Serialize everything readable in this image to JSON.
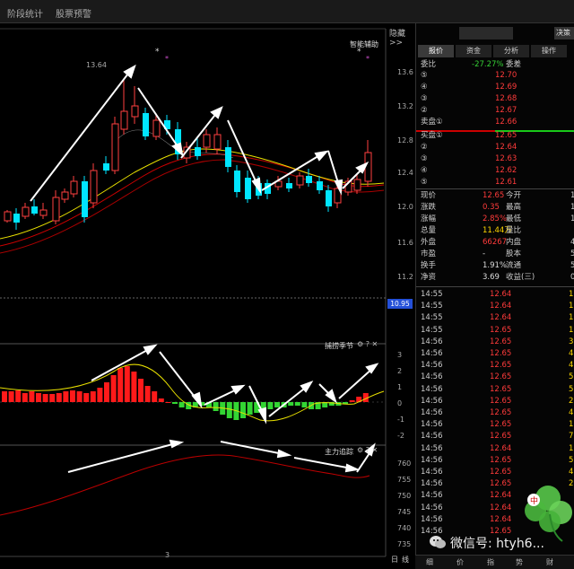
{
  "topbar": {
    "tab1": "阶段统计",
    "tab2": "股票预警"
  },
  "chart": {
    "hide_label": "隐藏>>",
    "assist_label": "智能辅助",
    "star": "*",
    "high_mark": "13.64",
    "current_price_tag": "10.95",
    "price_axis": [
      "13.6",
      "13.2",
      "12.8",
      "12.4",
      "12.0",
      "11.6",
      "11.2"
    ],
    "indicator1_label": "捕捞季节",
    "indicator1_axis": [
      "3",
      "2",
      "1",
      "0",
      "-1",
      "-2"
    ],
    "indicator2_label": "主力追踪",
    "indicator2_axis": [
      "760",
      "755",
      "750",
      "745",
      "740",
      "735"
    ],
    "bottom_number": "3",
    "bottom_right": [
      "日",
      "线"
    ]
  },
  "quote": {
    "top_btn": "决策",
    "tabs": [
      "报价",
      "资金",
      "分析",
      "操作"
    ],
    "weibi": {
      "label": "委比",
      "value": "-27.27%",
      "label2": "委差"
    },
    "sells": [
      {
        "level": "⑤",
        "price": "12.70"
      },
      {
        "level": "④",
        "price": "12.69"
      },
      {
        "level": "③",
        "price": "12.68"
      },
      {
        "level": "②",
        "price": "12.67"
      },
      {
        "level": "卖盘①",
        "price": "12.66"
      }
    ],
    "buys": [
      {
        "level": "买盘①",
        "price": "12.65"
      },
      {
        "level": "②",
        "price": "12.64"
      },
      {
        "level": "③",
        "price": "12.63"
      },
      {
        "level": "④",
        "price": "12.62"
      },
      {
        "level": "⑤",
        "price": "12.61"
      }
    ],
    "stats": [
      {
        "l1": "现价",
        "v1": "12.65",
        "l2": "今开",
        "v2": "1"
      },
      {
        "l1": "涨跌",
        "v1": "0.35",
        "l2": "最高",
        "v2": "1"
      },
      {
        "l1": "涨幅",
        "v1": "2.85%",
        "l2": "最低",
        "v2": "1"
      },
      {
        "l1": "总量",
        "v1": "11.44万",
        "l2": "量比",
        "v2": ""
      },
      {
        "l1": "外盘",
        "v1": "66267",
        "l2": "内盘",
        "v2": "4"
      },
      {
        "l1": "市盈",
        "v1": "-",
        "l2": "股本",
        "v2": "5."
      },
      {
        "l1": "换手",
        "v1": "1.91%",
        "l2": "流通",
        "v2": "5."
      },
      {
        "l1": "净资",
        "v1": "3.69",
        "l2": "收益(三)",
        "v2": "0"
      }
    ],
    "ticks": [
      {
        "t": "14:55",
        "p": "12.64",
        "v": "1"
      },
      {
        "t": "14:55",
        "p": "12.64",
        "v": "1"
      },
      {
        "t": "14:55",
        "p": "12.64",
        "v": "1"
      },
      {
        "t": "14:55",
        "p": "12.65",
        "v": "1"
      },
      {
        "t": "14:56",
        "p": "12.65",
        "v": "3"
      },
      {
        "t": "14:56",
        "p": "12.65",
        "v": "4"
      },
      {
        "t": "14:56",
        "p": "12.65",
        "v": "4"
      },
      {
        "t": "14:56",
        "p": "12.65",
        "v": "5"
      },
      {
        "t": "14:56",
        "p": "12.65",
        "v": "5"
      },
      {
        "t": "14:56",
        "p": "12.65",
        "v": "2"
      },
      {
        "t": "14:56",
        "p": "12.65",
        "v": "4"
      },
      {
        "t": "14:56",
        "p": "12.65",
        "v": "11"
      },
      {
        "t": "14:56",
        "p": "12.65",
        "v": "7"
      },
      {
        "t": "14:56",
        "p": "12.64",
        "v": "11"
      },
      {
        "t": "14:56",
        "p": "12.65",
        "v": "5"
      },
      {
        "t": "14:56",
        "p": "12.65",
        "v": "4"
      },
      {
        "t": "14:56",
        "p": "12.65",
        "v": "2"
      },
      {
        "t": "14:56",
        "p": "12.64",
        "v": ""
      },
      {
        "t": "14:56",
        "p": "12.64",
        "v": ""
      },
      {
        "t": "14:56",
        "p": "12.64",
        "v": ""
      },
      {
        "t": "14:56",
        "p": "12.65",
        "v": ""
      }
    ],
    "bottom_tabs": [
      "细",
      "价",
      "指",
      "势",
      "财"
    ]
  },
  "watermark": {
    "text": "微信号: htyh6..."
  }
}
